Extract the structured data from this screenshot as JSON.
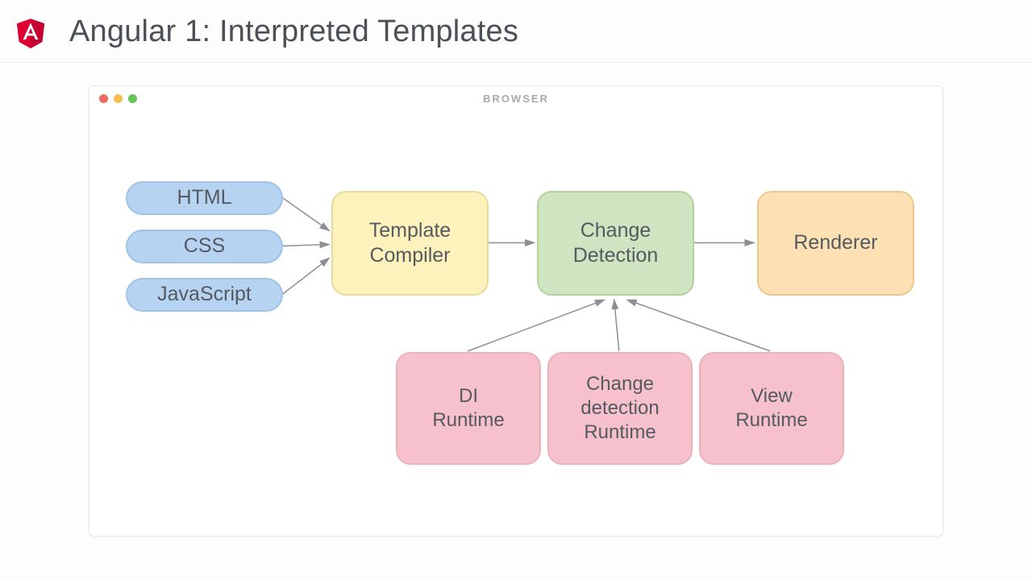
{
  "header": {
    "title": "Angular 1: Interpreted Templates"
  },
  "browser": {
    "label": "BROWSER"
  },
  "nodes": {
    "inputs": [
      {
        "label": "HTML"
      },
      {
        "label": "CSS"
      },
      {
        "label": "JavaScript"
      }
    ],
    "compiler": "Template\nCompiler",
    "detection": "Change\nDetection",
    "renderer": "Renderer",
    "runtimes": [
      "DI\nRuntime",
      "Change\ndetection\nRuntime",
      "View\nRuntime"
    ]
  }
}
